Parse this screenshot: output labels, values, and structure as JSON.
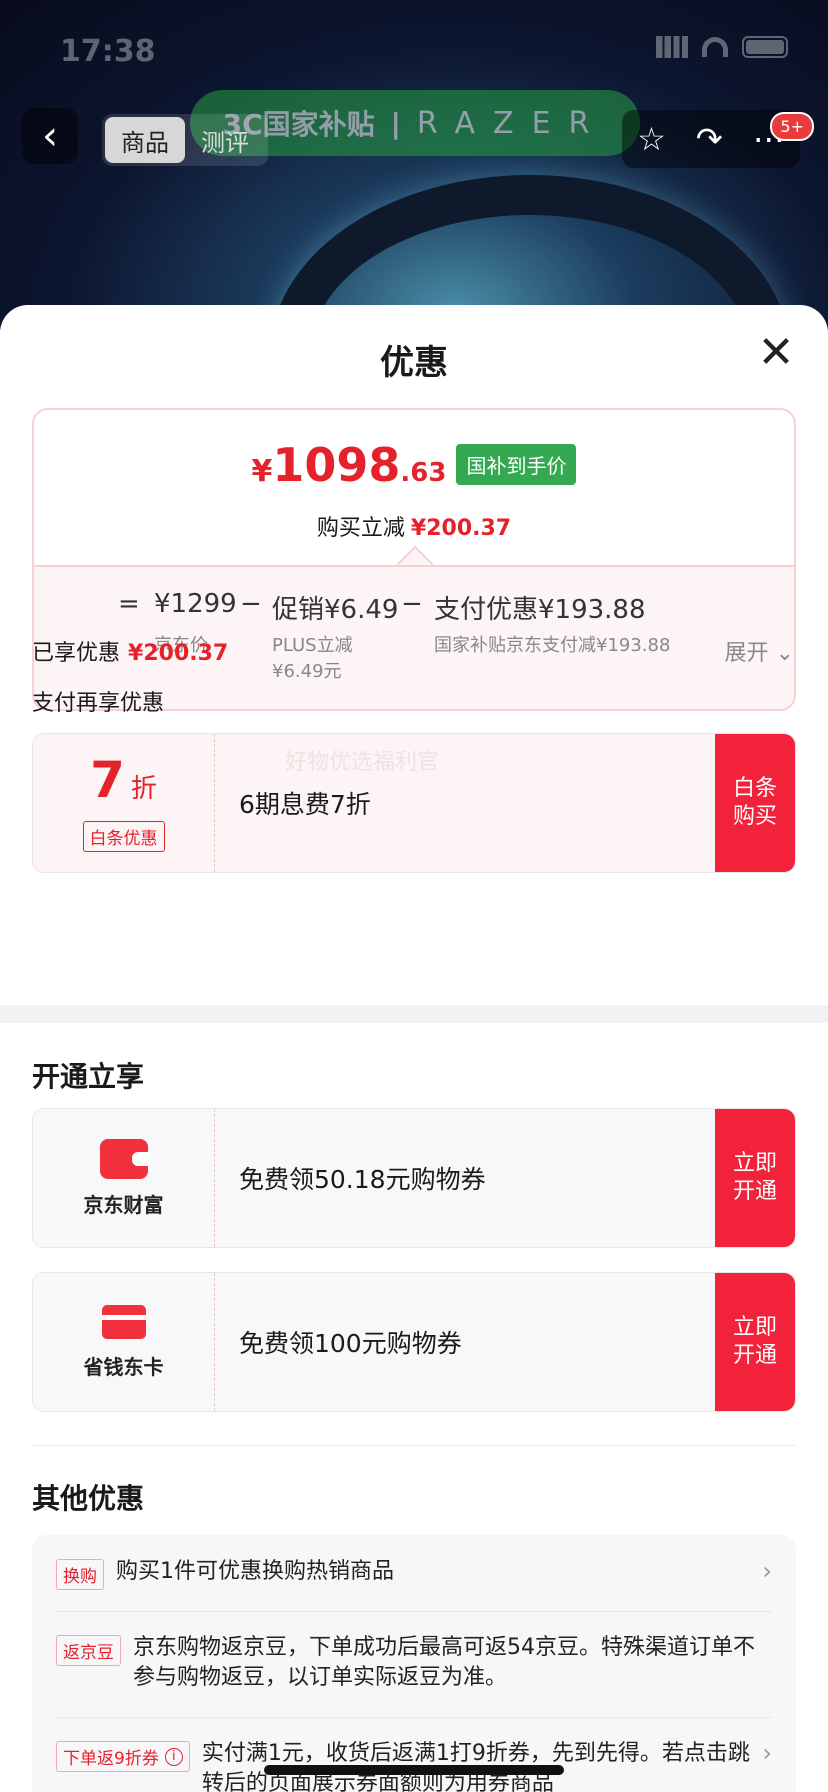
{
  "status": {
    "time": "17:38"
  },
  "nav": {
    "tabs": [
      {
        "label": "商品",
        "active": true
      },
      {
        "label": "测评",
        "active": false
      }
    ],
    "banner_text": "3C国家补贴",
    "banner_sep": "|",
    "banner_brand": "RAZER",
    "message_badge": "5+",
    "icons": [
      "back-icon",
      "star-icon",
      "share-icon",
      "more-icon"
    ]
  },
  "sheet": {
    "title": "优惠",
    "price": {
      "symbol": "¥",
      "integer": "1098",
      "decimal": ".63",
      "tag": "国补到手价",
      "sub_label": "购买立减",
      "sub_amount": "¥200.37"
    },
    "calc": {
      "eq": "=",
      "jd_price": "¥1299",
      "minus1": "−",
      "promo": "促销¥6.49",
      "minus2": "−",
      "pay": "支付优惠¥193.88",
      "jd_price_label": "京东价",
      "promo_label_1": "PLUS立减",
      "promo_label_2": "¥6.49元",
      "pay_label": "国家补贴京东支付减¥193.88"
    },
    "enjoyed_label": "已享优惠",
    "enjoyed_amount": "¥200.37",
    "expand_label": "展开",
    "pay_more_label": "支付再享优惠",
    "baitiao": {
      "discount": "7",
      "discount_unit": "折",
      "tag": "白条优惠",
      "watermark": "好物优选福利官",
      "desc": "6期息费7折",
      "button": "白条购买"
    },
    "open_section_title": "开通立享",
    "open_offers": [
      {
        "name": "京东财富",
        "icon": "wallet-icon",
        "desc": "免费领50.18元购物券",
        "button": "立即开通"
      },
      {
        "name": "省钱东卡",
        "icon": "card-icon",
        "desc": "免费领100元购物券",
        "button": "立即开通"
      }
    ],
    "other_section_title": "其他优惠",
    "other_offers": [
      {
        "tag": "换购",
        "text": "购买1件可优惠换购热销商品"
      },
      {
        "tag": "返京豆",
        "text": "京东购物返京豆，下单成功后最高可返54京豆。特殊渠道订单不参与购物返豆，以订单实际返豆为准。"
      },
      {
        "tag": "下单返9折券",
        "text": "实付满1元，收货后返满1打9折券，先到先得。若点击跳转后的页面展示券面额则为用券商品"
      }
    ]
  },
  "colors": {
    "accent_red": "#e4222b",
    "button_red": "#f2223b",
    "subsidy_green": "#34a952"
  }
}
